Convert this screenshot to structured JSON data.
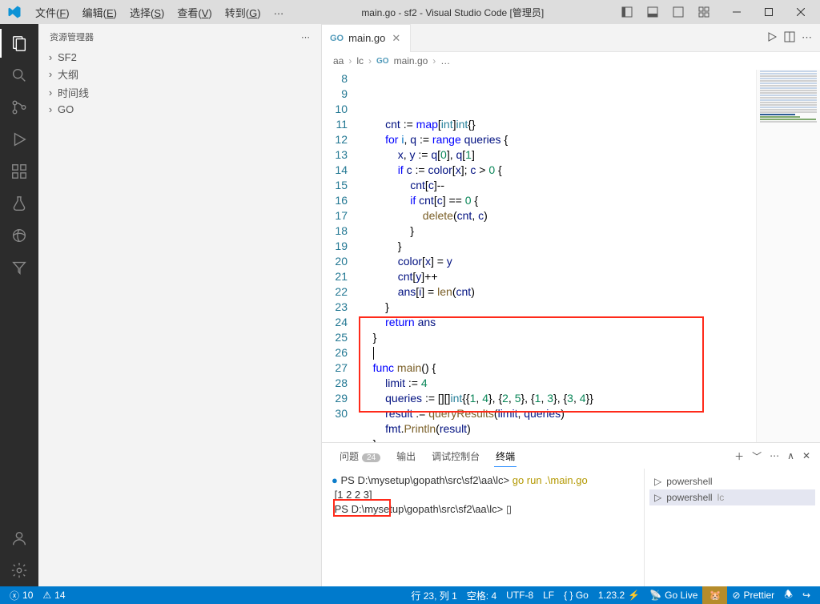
{
  "titlebar": {
    "menus": [
      "文件(F)",
      "编辑(E)",
      "选择(S)",
      "查看(V)",
      "转到(G)",
      "…"
    ],
    "title": "main.go - sf2 - Visual Studio Code [管理员]"
  },
  "sidebar": {
    "title": "资源管理器",
    "items": [
      "SF2",
      "大纲",
      "时间线",
      "GO"
    ]
  },
  "tab": {
    "icon": "GO",
    "label": "main.go"
  },
  "breadcrumb": {
    "parts": [
      "aa",
      "lc"
    ],
    "file": "main.go",
    "trail": "…"
  },
  "code": {
    "lines": [
      {
        "n": 8,
        "ind": 2,
        "t": [
          [
            "var",
            "cnt "
          ],
          [
            "op",
            ":= "
          ],
          [
            "kw",
            "map"
          ],
          [
            "op",
            "["
          ],
          [
            "typ",
            "int"
          ],
          [
            "op",
            "]"
          ],
          [
            "typ",
            "int"
          ],
          [
            "op",
            "{}"
          ]
        ]
      },
      {
        "n": 9,
        "ind": 2,
        "t": [
          [
            "kw",
            "for "
          ],
          [
            "bay",
            "i"
          ],
          [
            "op",
            ", "
          ],
          [
            "var",
            "q "
          ],
          [
            "op",
            ":= "
          ],
          [
            "kw",
            "range "
          ],
          [
            "var",
            "queries "
          ],
          [
            "op",
            "{"
          ]
        ]
      },
      {
        "n": 10,
        "ind": 3,
        "t": [
          [
            "var",
            "x"
          ],
          [
            "op",
            ", "
          ],
          [
            "var",
            "y "
          ],
          [
            "op",
            ":= "
          ],
          [
            "var",
            "q"
          ],
          [
            "op",
            "["
          ],
          [
            "num",
            "0"
          ],
          [
            "op",
            "], "
          ],
          [
            "var",
            "q"
          ],
          [
            "op",
            "["
          ],
          [
            "num",
            "1"
          ],
          [
            "op",
            "]"
          ]
        ]
      },
      {
        "n": 11,
        "ind": 3,
        "t": [
          [
            "kw",
            "if "
          ],
          [
            "var",
            "c "
          ],
          [
            "op",
            ":= "
          ],
          [
            "var",
            "color"
          ],
          [
            "op",
            "["
          ],
          [
            "var",
            "x"
          ],
          [
            "op",
            "]; "
          ],
          [
            "var",
            "c "
          ],
          [
            "op",
            "> "
          ],
          [
            "num",
            "0 "
          ],
          [
            "op",
            "{"
          ]
        ]
      },
      {
        "n": 12,
        "ind": 4,
        "t": [
          [
            "var",
            "cnt"
          ],
          [
            "op",
            "["
          ],
          [
            "var",
            "c"
          ],
          [
            "op",
            "]--"
          ]
        ]
      },
      {
        "n": 13,
        "ind": 4,
        "t": [
          [
            "kw",
            "if "
          ],
          [
            "var",
            "cnt"
          ],
          [
            "op",
            "["
          ],
          [
            "var",
            "c"
          ],
          [
            "op",
            "] == "
          ],
          [
            "num",
            "0 "
          ],
          [
            "op",
            "{"
          ]
        ]
      },
      {
        "n": 14,
        "ind": 5,
        "t": [
          [
            "fn",
            "delete"
          ],
          [
            "op",
            "("
          ],
          [
            "var",
            "cnt"
          ],
          [
            "op",
            ", "
          ],
          [
            "var",
            "c"
          ],
          [
            "op",
            ")"
          ]
        ]
      },
      {
        "n": 15,
        "ind": 4,
        "t": [
          [
            "op",
            "}"
          ]
        ]
      },
      {
        "n": 16,
        "ind": 3,
        "t": [
          [
            "op",
            "}"
          ]
        ]
      },
      {
        "n": 17,
        "ind": 3,
        "t": [
          [
            "var",
            "color"
          ],
          [
            "op",
            "["
          ],
          [
            "var",
            "x"
          ],
          [
            "op",
            "] = "
          ],
          [
            "var",
            "y"
          ]
        ]
      },
      {
        "n": 18,
        "ind": 3,
        "t": [
          [
            "var",
            "cnt"
          ],
          [
            "op",
            "["
          ],
          [
            "var",
            "y"
          ],
          [
            "op",
            "]++"
          ]
        ]
      },
      {
        "n": 19,
        "ind": 3,
        "t": [
          [
            "var",
            "ans"
          ],
          [
            "op",
            "["
          ],
          [
            "var",
            "i"
          ],
          [
            "op",
            "] = "
          ],
          [
            "fn",
            "len"
          ],
          [
            "op",
            "("
          ],
          [
            "var",
            "cnt"
          ],
          [
            "op",
            ")"
          ]
        ]
      },
      {
        "n": 20,
        "ind": 2,
        "t": [
          [
            "op",
            "}"
          ]
        ]
      },
      {
        "n": 21,
        "ind": 2,
        "t": [
          [
            "kw",
            "return "
          ],
          [
            "var",
            "ans"
          ]
        ]
      },
      {
        "n": 22,
        "ind": 1,
        "t": [
          [
            "op",
            "}"
          ]
        ]
      },
      {
        "n": 23,
        "ind": 1,
        "t": [
          [
            "cursor",
            ""
          ]
        ]
      },
      {
        "n": 24,
        "ind": 1,
        "t": [
          [
            "kw",
            "func "
          ],
          [
            "fn",
            "main"
          ],
          [
            "op",
            "() {"
          ]
        ]
      },
      {
        "n": 25,
        "ind": 2,
        "t": [
          [
            "var",
            "limit "
          ],
          [
            "op",
            ":= "
          ],
          [
            "num",
            "4"
          ]
        ]
      },
      {
        "n": 26,
        "ind": 2,
        "t": [
          [
            "var",
            "queries "
          ],
          [
            "op",
            ":= [][]"
          ],
          [
            "typ",
            "int"
          ],
          [
            "op",
            "{{"
          ],
          [
            "num",
            "1"
          ],
          [
            "op",
            ", "
          ],
          [
            "num",
            "4"
          ],
          [
            "op",
            "}, {"
          ],
          [
            "num",
            "2"
          ],
          [
            "op",
            ", "
          ],
          [
            "num",
            "5"
          ],
          [
            "op",
            "}, {"
          ],
          [
            "num",
            "1"
          ],
          [
            "op",
            ", "
          ],
          [
            "num",
            "3"
          ],
          [
            "op",
            "}, {"
          ],
          [
            "num",
            "3"
          ],
          [
            "op",
            ", "
          ],
          [
            "num",
            "4"
          ],
          [
            "op",
            "}}"
          ]
        ]
      },
      {
        "n": 27,
        "ind": 2,
        "t": [
          [
            "var",
            "result "
          ],
          [
            "op",
            ":= "
          ],
          [
            "fn",
            "queryResults"
          ],
          [
            "op",
            "("
          ],
          [
            "var",
            "limit"
          ],
          [
            "op",
            ", "
          ],
          [
            "var",
            "queries"
          ],
          [
            "op",
            ")"
          ]
        ]
      },
      {
        "n": 28,
        "ind": 2,
        "t": [
          [
            "var",
            "fmt"
          ],
          [
            "op",
            "."
          ],
          [
            "fn",
            "Println"
          ],
          [
            "op",
            "("
          ],
          [
            "var",
            "result"
          ],
          [
            "op",
            ")"
          ]
        ]
      },
      {
        "n": 29,
        "ind": 1,
        "t": [
          [
            "op",
            "}"
          ]
        ]
      },
      {
        "n": 30,
        "ind": 1,
        "t": []
      }
    ]
  },
  "panel": {
    "tabs": {
      "problems": "问题",
      "problems_count": "24",
      "output": "输出",
      "debug": "调试控制台",
      "terminal": "终端"
    },
    "terminal": {
      "line1_prompt": "PS D:\\mysetup\\gopath\\src\\sf2\\aa\\lc>",
      "line1_cmd": " go run .\\main.go",
      "line2": "[1 2 2 3]",
      "line3_prompt": "PS D:\\mysetup\\gopath\\src\\sf2\\aa\\lc>",
      "line3_cursor": "▯"
    },
    "shells": [
      {
        "name": "powershell",
        "sub": ""
      },
      {
        "name": "powershell",
        "sub": "lc"
      }
    ]
  },
  "status": {
    "errors": "10",
    "warnings": "14",
    "pos": "行 23, 列 1",
    "spaces": "空格: 4",
    "enc": "UTF-8",
    "eol": "LF",
    "lang": "{ } Go",
    "ver": "1.23.2",
    "golive": "Go Live",
    "prettier": "Prettier"
  }
}
